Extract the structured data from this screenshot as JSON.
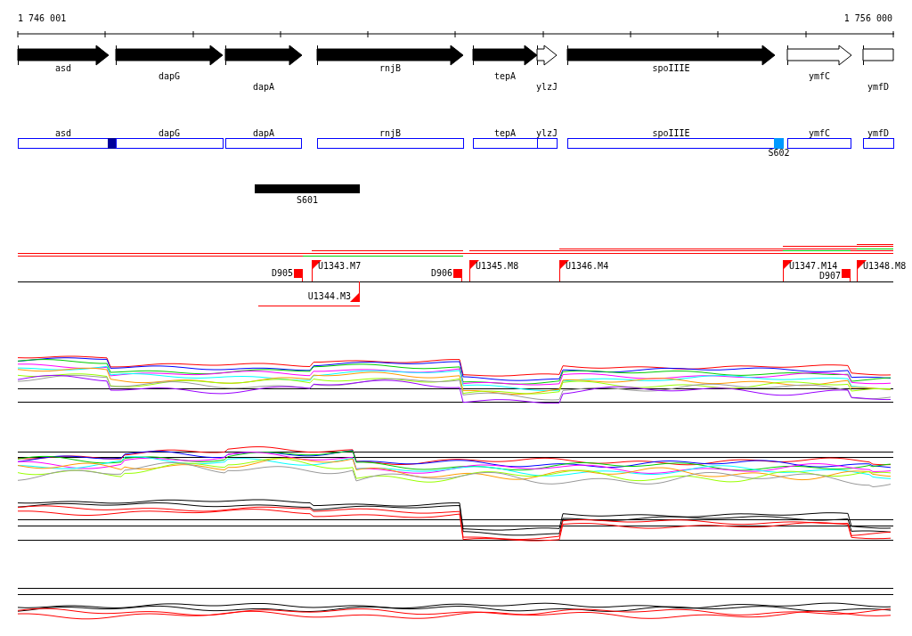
{
  "ruler": {
    "start": "1 746 001",
    "end": "1 756 000"
  },
  "genes": [
    {
      "name": "asd",
      "filled": true
    },
    {
      "name": "dapG",
      "filled": true
    },
    {
      "name": "dapA",
      "filled": true
    },
    {
      "name": "rnjB",
      "filled": true
    },
    {
      "name": "tepA",
      "filled": true
    },
    {
      "name": "ylzJ",
      "filled": false
    },
    {
      "name": "spoIIIE",
      "filled": true
    },
    {
      "name": "ymfC",
      "filled": false
    },
    {
      "name": "ymfD",
      "filled": false
    }
  ],
  "feature_track": [
    {
      "name": "asd"
    },
    {
      "name": "dapG"
    },
    {
      "name": "dapA"
    },
    {
      "name": "rnjB"
    },
    {
      "name": "tepA"
    },
    {
      "name": "ylzJ"
    },
    {
      "name": "spoIIIE"
    },
    {
      "name": "ymfC"
    },
    {
      "name": "ymfD"
    }
  ],
  "sites": [
    {
      "label": "S602"
    }
  ],
  "regions": [
    {
      "label": "S601"
    }
  ],
  "markers": [
    {
      "label": "D905",
      "kind": "square"
    },
    {
      "label": "U1343.M7",
      "kind": "flag"
    },
    {
      "label": "U1344.M3",
      "kind": "flag-below"
    },
    {
      "label": "D906",
      "kind": "square"
    },
    {
      "label": "U1345.M8",
      "kind": "flag"
    },
    {
      "label": "U1346.M4",
      "kind": "flag"
    },
    {
      "label": "U1347.M14",
      "kind": "flag"
    },
    {
      "label": "D907",
      "kind": "square"
    },
    {
      "label": "U1348.M8",
      "kind": "flag"
    }
  ]
}
